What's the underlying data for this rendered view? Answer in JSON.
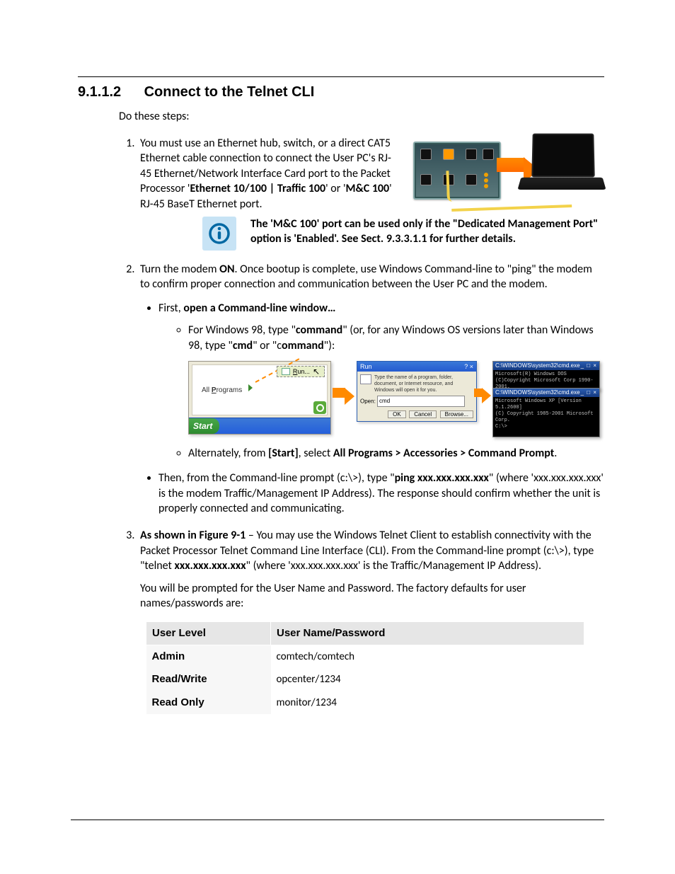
{
  "heading": {
    "number": "9.1.1.2",
    "title": "Connect to the Telnet CLI"
  },
  "intro": "Do these steps:",
  "step1": {
    "pre": "You must use an Ethernet hub, switch, or a direct CAT5 Ethernet cable connection to connect the User PC's RJ-45 Ethernet/Network Interface Card port to the Packet Processor '",
    "bold1": "Ethernet 10/100 | Traffic 100",
    "mid": "' or '",
    "bold2": "M&C 100",
    "post": "' RJ-45 BaseT Ethernet port."
  },
  "note": "The 'M&C 100' port can be used only if the \"Dedicated Management Port\" option is 'Enabled'. See Sect. 9.3.3.1.1 for further details.",
  "step2": {
    "p1a": "Turn the modem ",
    "p1b": "ON",
    "p1c": ". Once bootup is complete, use Windows Command-line to \"ping\" the modem to confirm proper connection and communication between the User PC and the modem.",
    "bullet1a": "First, ",
    "bullet1b": "open a Command-line window…",
    "sub1a": "For Windows 98, type \"",
    "sub1b": "command",
    "sub1c": "\" (or, for any Windows OS versions later than Windows 98, type \"",
    "sub1d": "cmd",
    "sub1e": "\" or \"c",
    "sub1f": "ommand",
    "sub1g": "\"):",
    "sub2a": "Alternately, from ",
    "sub2b": "[Start]",
    "sub2c": ", select ",
    "sub2d": "All Programs > Accessories > Command Prompt",
    "sub2e": ".",
    "bullet2a": "Then, from the Command-line prompt (c:\\>), type \"",
    "bullet2b": "ping xxx.xxx.xxx.xxx",
    "bullet2c": "\" (where 'xxx.xxx.xxx.xxx' is the modem Traffic/Management IP Address). The response should confirm whether the unit is properly connected and communicating."
  },
  "step3": {
    "p1a": "As shown in Figure 9-1",
    "p1b": " – You may use the Windows Telnet Client to establish connectivity with the Packet Processor Telnet Command Line Interface (CLI).  From the Command-line prompt (c:\\>), type \"telnet ",
    "p1c": "xxx.xxx.xxx.xxx",
    "p1d": "\" (where 'xxx.xxx.xxx.xxx' is the Traffic/Management IP Address).",
    "p2": "You will be prompted for the User Name and Password. The factory defaults for user names/passwords are:"
  },
  "table": {
    "h1": "User Level",
    "h2": "User Name/Password",
    "rows": [
      {
        "level": "Admin",
        "cred": "comtech/comtech"
      },
      {
        "level": "Read/Write",
        "cred": "opcenter/1234"
      },
      {
        "level": "Read Only",
        "cred": "monitor/1234"
      }
    ]
  },
  "fig": {
    "allprograms": "All Programs",
    "run": "Run...",
    "start": "Start",
    "runTitle": "Run",
    "runDesc": "Type the name of a program, folder, document, or Internet resource, and Windows will open it for you.",
    "openLabel": "Open:",
    "openValue": "cmd",
    "ok": "OK",
    "cancel": "Cancel",
    "browse": "Browse...",
    "cmdTitleA": "C:\\WINDOWS\\system32\\cmd.exe",
    "cmdBodyA": "Microsoft(R) Windows DOS\n(C)Copyright Microsoft Corp 1990-2001.\nC:\\>",
    "cmdTitleB": "C:\\WINDOWS\\system32\\cmd.exe",
    "cmdBodyB": "Microsoft Windows XP [Version 5.1.2600]\n(C) Copyright 1985-2001 Microsoft Corp.\nC:\\>",
    "winCtl": "_ □ ×"
  }
}
